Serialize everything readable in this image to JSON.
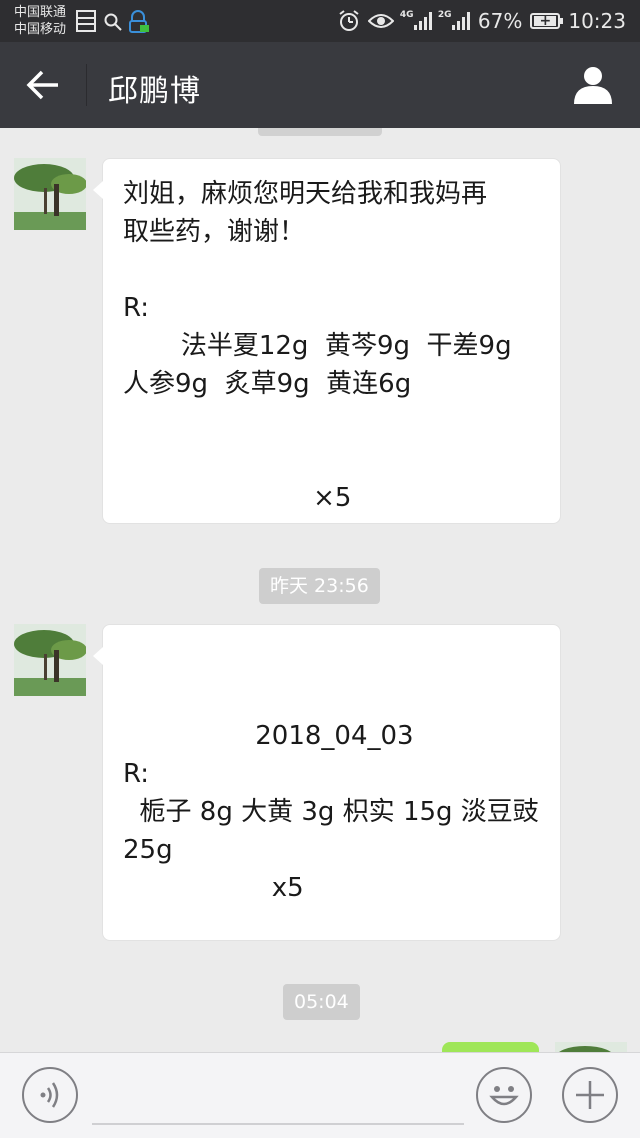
{
  "status_bar": {
    "carrier_1": "中国联通",
    "carrier_2": "中国移动",
    "network_1": "4G",
    "network_2": "2G",
    "battery_text": "67%",
    "time": "10:23",
    "icons": [
      "storage-icon",
      "search-icon",
      "vpn-icon",
      "alarm-icon",
      "eye-icon",
      "signal-icon",
      "battery-icon"
    ]
  },
  "header": {
    "title": "邱鹏博",
    "back_icon": "arrow-left-icon",
    "profile_icon": "person-icon"
  },
  "messages": [
    {
      "sender": "contact",
      "lines": [
        "刘姐，麻烦您明天给我和我妈再",
        "取些药，谢谢！",
        "",
        "R:",
        "       法半夏12g  黄芩9g  干差9g",
        "人参9g  炙草9g  黄连6g",
        "",
        "",
        "                       ×5"
      ]
    },
    {
      "timestamp": "昨天 23:56"
    },
    {
      "sender": "contact",
      "lines": [
        "",
        "",
        "                2018_04_03",
        "R:",
        "  栀子 8g 大黄 3g 枳实 15g 淡豆豉",
        "25g",
        "                  x5"
      ]
    },
    {
      "timestamp": "05:04"
    }
  ],
  "input_bar": {
    "voice_icon": "voice-icon",
    "emoji_icon": "emoji-icon",
    "plus_icon": "plus-icon",
    "placeholder": ""
  },
  "colors": {
    "status_bar_bg": "#2e2e31",
    "title_bar_bg": "#393a3f",
    "chat_bg": "#ebebeb",
    "sent_bubble": "#9fe658"
  }
}
